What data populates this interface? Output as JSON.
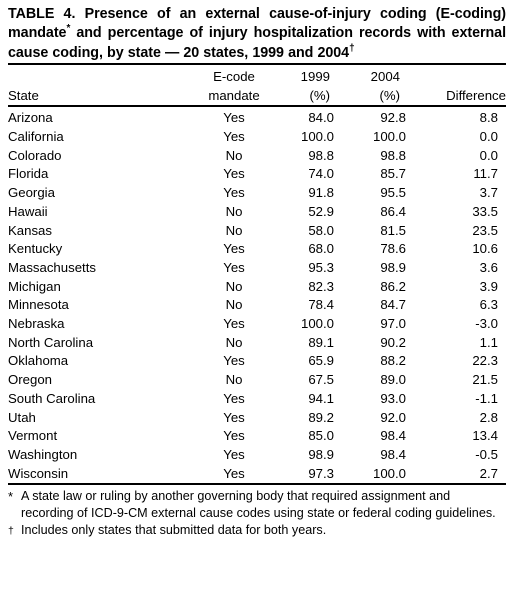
{
  "title": {
    "line1": "TABLE 4. Presence of an external cause-of-injury coding",
    "line2_a": "(E-coding) mandate",
    "line2_sup": "*",
    "line2_b": " and percentage of injury hospitalization",
    "line3": "records with external cause coding, by state — 20 states,",
    "line4_a": "1999 and 2004",
    "line4_sup": "†"
  },
  "table": {
    "headers": {
      "state": "State",
      "mandate_line1": "E-code",
      "mandate_line2": "mandate",
      "y1999_line1": "1999",
      "y1999_line2": "(%)",
      "y2004_line1": "2004",
      "y2004_line2": "(%)",
      "difference": "Difference"
    },
    "rows": [
      {
        "state": "Arizona",
        "mandate": "Yes",
        "y1999": "84.0",
        "y2004": "92.8",
        "difference": "8.8"
      },
      {
        "state": "California",
        "mandate": "Yes",
        "y1999": "100.0",
        "y2004": "100.0",
        "difference": "0.0"
      },
      {
        "state": "Colorado",
        "mandate": "No",
        "y1999": "98.8",
        "y2004": "98.8",
        "difference": "0.0"
      },
      {
        "state": "Florida",
        "mandate": "Yes",
        "y1999": "74.0",
        "y2004": "85.7",
        "difference": "11.7"
      },
      {
        "state": "Georgia",
        "mandate": "Yes",
        "y1999": "91.8",
        "y2004": "95.5",
        "difference": "3.7"
      },
      {
        "state": "Hawaii",
        "mandate": "No",
        "y1999": "52.9",
        "y2004": "86.4",
        "difference": "33.5"
      },
      {
        "state": "Kansas",
        "mandate": "No",
        "y1999": "58.0",
        "y2004": "81.5",
        "difference": "23.5"
      },
      {
        "state": "Kentucky",
        "mandate": "Yes",
        "y1999": "68.0",
        "y2004": "78.6",
        "difference": "10.6"
      },
      {
        "state": "Massachusetts",
        "mandate": "Yes",
        "y1999": "95.3",
        "y2004": "98.9",
        "difference": "3.6"
      },
      {
        "state": "Michigan",
        "mandate": "No",
        "y1999": "82.3",
        "y2004": "86.2",
        "difference": "3.9"
      },
      {
        "state": "Minnesota",
        "mandate": "No",
        "y1999": "78.4",
        "y2004": "84.7",
        "difference": "6.3"
      },
      {
        "state": "Nebraska",
        "mandate": "Yes",
        "y1999": "100.0",
        "y2004": "97.0",
        "difference": "-3.0"
      },
      {
        "state": "North Carolina",
        "mandate": "No",
        "y1999": "89.1",
        "y2004": "90.2",
        "difference": "1.1"
      },
      {
        "state": "Oklahoma",
        "mandate": "Yes",
        "y1999": "65.9",
        "y2004": "88.2",
        "difference": "22.3"
      },
      {
        "state": "Oregon",
        "mandate": "No",
        "y1999": "67.5",
        "y2004": "89.0",
        "difference": "21.5"
      },
      {
        "state": "South Carolina",
        "mandate": "Yes",
        "y1999": "94.1",
        "y2004": "93.0",
        "difference": "-1.1"
      },
      {
        "state": "Utah",
        "mandate": "Yes",
        "y1999": "89.2",
        "y2004": "92.0",
        "difference": "2.8"
      },
      {
        "state": "Vermont",
        "mandate": "Yes",
        "y1999": "85.0",
        "y2004": "98.4",
        "difference": "13.4"
      },
      {
        "state": "Washington",
        "mandate": "Yes",
        "y1999": "98.9",
        "y2004": "98.4",
        "difference": "-0.5"
      },
      {
        "state": "Wisconsin",
        "mandate": "Yes",
        "y1999": "97.3",
        "y2004": "100.0",
        "difference": "2.7"
      }
    ]
  },
  "footnotes": [
    {
      "marker": "*",
      "text": "A state law or ruling by another governing body that required assignment and recording of ICD-9-CM external cause codes using state or federal coding guidelines."
    },
    {
      "marker": "†",
      "text": "Includes only states that submitted data for both years."
    }
  ],
  "chart_data": {
    "type": "table",
    "title": "TABLE 4. Presence of an external cause-of-injury coding (E-coding) mandate* and percentage of injury hospitalization records with external cause coding, by state — 20 states, 1999 and 2004†",
    "columns": [
      "State",
      "E-code mandate",
      "1999 (%)",
      "2004 (%)",
      "Difference"
    ],
    "categories": [
      "Arizona",
      "California",
      "Colorado",
      "Florida",
      "Georgia",
      "Hawaii",
      "Kansas",
      "Kentucky",
      "Massachusetts",
      "Michigan",
      "Minnesota",
      "Nebraska",
      "North Carolina",
      "Oklahoma",
      "Oregon",
      "South Carolina",
      "Utah",
      "Vermont",
      "Washington",
      "Wisconsin"
    ],
    "series": [
      {
        "name": "E-code mandate",
        "values": [
          "Yes",
          "Yes",
          "No",
          "Yes",
          "Yes",
          "No",
          "No",
          "Yes",
          "Yes",
          "No",
          "No",
          "Yes",
          "No",
          "Yes",
          "No",
          "Yes",
          "Yes",
          "Yes",
          "Yes",
          "Yes"
        ]
      },
      {
        "name": "1999 (%)",
        "values": [
          84.0,
          100.0,
          98.8,
          74.0,
          91.8,
          52.9,
          58.0,
          68.0,
          95.3,
          82.3,
          78.4,
          100.0,
          89.1,
          65.9,
          67.5,
          94.1,
          89.2,
          85.0,
          98.9,
          97.3
        ]
      },
      {
        "name": "2004 (%)",
        "values": [
          92.8,
          100.0,
          98.8,
          85.7,
          95.5,
          86.4,
          81.5,
          78.6,
          98.9,
          86.2,
          84.7,
          97.0,
          90.2,
          88.2,
          89.0,
          93.0,
          92.0,
          98.4,
          98.4,
          100.0
        ]
      },
      {
        "name": "Difference",
        "values": [
          8.8,
          0.0,
          0.0,
          11.7,
          3.7,
          33.5,
          23.5,
          10.6,
          3.6,
          3.9,
          6.3,
          -3.0,
          1.1,
          22.3,
          21.5,
          -1.1,
          2.8,
          13.4,
          -0.5,
          2.7
        ]
      }
    ],
    "xlabel": "State",
    "ylabel": "Percentage of injury hospitalization records with external cause coding",
    "ylim": [
      0,
      100
    ],
    "grid": false,
    "legend": "none"
  }
}
